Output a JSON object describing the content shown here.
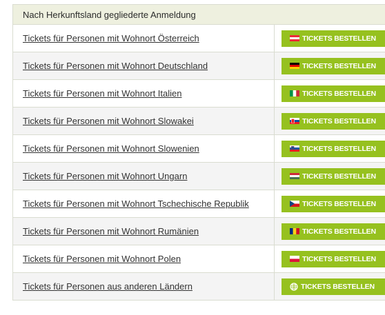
{
  "section": {
    "title": "Nach Herkunftsland gegliederte Anmeldung"
  },
  "colors": {
    "button_green": "#96c11f",
    "header_bg": "#eef0df"
  },
  "rows": [
    {
      "link": "Tickets für Personen mit Wohnort Österreich",
      "button": "TICKETS BESTELLEN",
      "icon": "flag-austria-icon"
    },
    {
      "link": "Tickets für Personen mit Wohnort Deutschland",
      "button": "TICKETS BESTELLEN",
      "icon": "flag-germany-icon"
    },
    {
      "link": "Tickets für Personen mit Wohnort Italien",
      "button": "TICKETS BESTELLEN",
      "icon": "flag-italy-icon"
    },
    {
      "link": "Tickets für Personen mit Wohnort Slowakei",
      "button": "TICKETS BESTELLEN",
      "icon": "flag-slovakia-icon"
    },
    {
      "link": "Tickets für Personen mit Wohnort Slowenien",
      "button": "TICKETS BESTELLEN",
      "icon": "flag-slovenia-icon"
    },
    {
      "link": "Tickets für Personen mit Wohnort Ungarn",
      "button": "TICKETS BESTELLEN",
      "icon": "flag-hungary-icon"
    },
    {
      "link": "Tickets für Personen mit Wohnort Tschechische Republik",
      "button": "TICKETS BESTELLEN",
      "icon": "flag-czech-icon"
    },
    {
      "link": "Tickets für Personen mit Wohnort Rumänien",
      "button": "TICKETS BESTELLEN",
      "icon": "flag-romania-icon"
    },
    {
      "link": "Tickets für Personen mit Wohnort Polen",
      "button": "TICKETS BESTELLEN",
      "icon": "flag-poland-icon"
    },
    {
      "link": "Tickets für Personen aus anderen Ländern",
      "button": "TICKETS BESTELLEN",
      "icon": "globe-icon"
    }
  ]
}
